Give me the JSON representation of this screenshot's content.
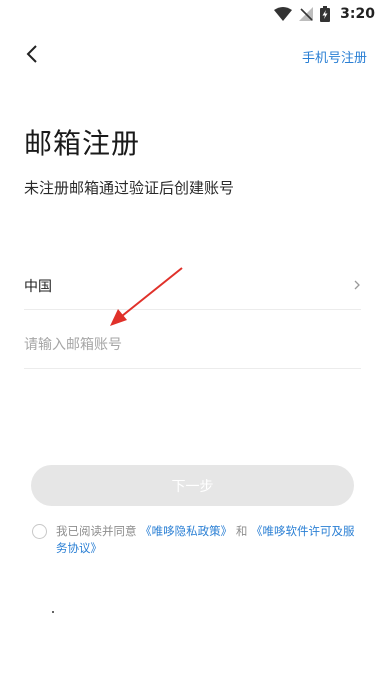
{
  "status_bar": {
    "time": "3:20",
    "icons": [
      "wifi-icon",
      "no-signal-icon",
      "battery-charging-icon"
    ]
  },
  "header": {
    "back_icon": "chevron-left-icon",
    "phone_register_link": "手机号注册"
  },
  "main": {
    "title": "邮箱注册",
    "subtitle": "未注册邮箱通过验证后创建账号",
    "country": {
      "label": "中国",
      "icon": "chevron-right-icon"
    },
    "email": {
      "placeholder": "请输入邮箱账号",
      "value": ""
    },
    "next_button": "下一步"
  },
  "agreement": {
    "prefix": "我已阅读并同意",
    "privacy_link": "《唯哆隐私政策》",
    "conjunction": "和",
    "license_link": "《唯哆软件许可及服务协议》"
  },
  "colors": {
    "accent": "#2a7fd4",
    "annotation_arrow": "#e0312a",
    "button_disabled": "#e6e6e6"
  }
}
